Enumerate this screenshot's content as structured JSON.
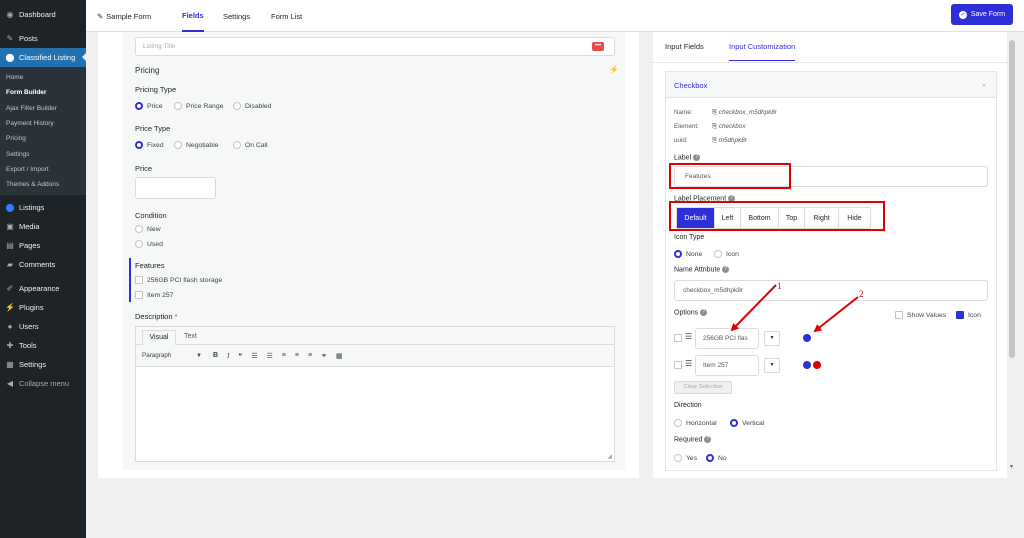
{
  "sidebar": {
    "items_top": [
      {
        "label": "Dashboard",
        "icon": "dashboard-icon"
      },
      {
        "label": "Posts",
        "icon": "pin-icon"
      }
    ],
    "active": {
      "label": "Classified Listing",
      "icon": "location-icon"
    },
    "submenu": [
      "Home",
      "Form Builder",
      "Ajax Filter Builder",
      "Payment History",
      "Pricing",
      "Settings",
      "Export / Import",
      "Themes & Addons"
    ],
    "items_bottom": [
      {
        "label": "Listings",
        "icon": "location-icon"
      },
      {
        "label": "Media",
        "icon": "media-icon"
      },
      {
        "label": "Pages",
        "icon": "pages-icon"
      },
      {
        "label": "Comments",
        "icon": "comment-icon"
      },
      {
        "label": "Appearance",
        "icon": "brush-icon"
      },
      {
        "label": "Plugins",
        "icon": "plug-icon"
      },
      {
        "label": "Users",
        "icon": "user-icon"
      },
      {
        "label": "Tools",
        "icon": "wrench-icon"
      },
      {
        "label": "Settings",
        "icon": "settings-icon"
      },
      {
        "label": "Collapse menu",
        "icon": "collapse-icon"
      }
    ]
  },
  "topbar": {
    "form_name": "Sample Form",
    "tabs": [
      "Fields",
      "Settings",
      "Form List"
    ],
    "save_label": "Save Form"
  },
  "form": {
    "listing_title_placeholder": "Listing Title",
    "pricing_section": "Pricing",
    "pricing_type_label": "Pricing Type",
    "pricing_type_options": [
      "Price",
      "Price Range",
      "Disabled"
    ],
    "price_type_label": "Price Type",
    "price_type_options": [
      "Fixed",
      "Negotiable",
      "On Call"
    ],
    "price_label": "Price",
    "condition_label": "Condition",
    "condition_options": [
      "New",
      "Used"
    ],
    "features_label": "Features",
    "features_options": [
      "256GB PCI flash storage",
      "Item 257"
    ],
    "description_label": "Description",
    "required_marker": "*",
    "editor_tabs": [
      "Visual",
      "Text"
    ],
    "paragraph_select": "Paragraph"
  },
  "right": {
    "tabs": [
      "Input Fields",
      "Input Customization"
    ],
    "card_title": "Checkbox",
    "meta": [
      {
        "key": "Name:",
        "value": "checkbox_m5dhpk8r"
      },
      {
        "key": "Element:",
        "value": "checkbox"
      },
      {
        "key": "uuid:",
        "value": "m5dhpk8r"
      }
    ],
    "label_title": "Label",
    "label_value": "Features",
    "placement_title": "Label Placement",
    "placement_options": [
      "Default",
      "Left",
      "Bottom",
      "Top",
      "Right",
      "Hide"
    ],
    "icon_type_title": "Icon Type",
    "icon_type_options": [
      "None",
      "Icon"
    ],
    "name_attr_title": "Name Attribute",
    "name_attr_value": "checkbox_m5dhpk8r",
    "options_title": "Options",
    "show_values_label": "Show Values",
    "icon_label": "Icon",
    "option_values": [
      "256GB PCI flas",
      "Item 257"
    ],
    "clear_selection": "Clear Selection",
    "direction_title": "Direction",
    "direction_options": [
      "Horizontal",
      "Vertical"
    ],
    "required_title": "Required",
    "required_options": [
      "Yes",
      "No"
    ]
  },
  "annotations": {
    "one": "1",
    "two": "2"
  },
  "colors": {
    "accent": "#2f2fd8",
    "annotation": "#e00000",
    "wp_sidebar": "#1d2327",
    "wp_blue": "#2271b1"
  }
}
